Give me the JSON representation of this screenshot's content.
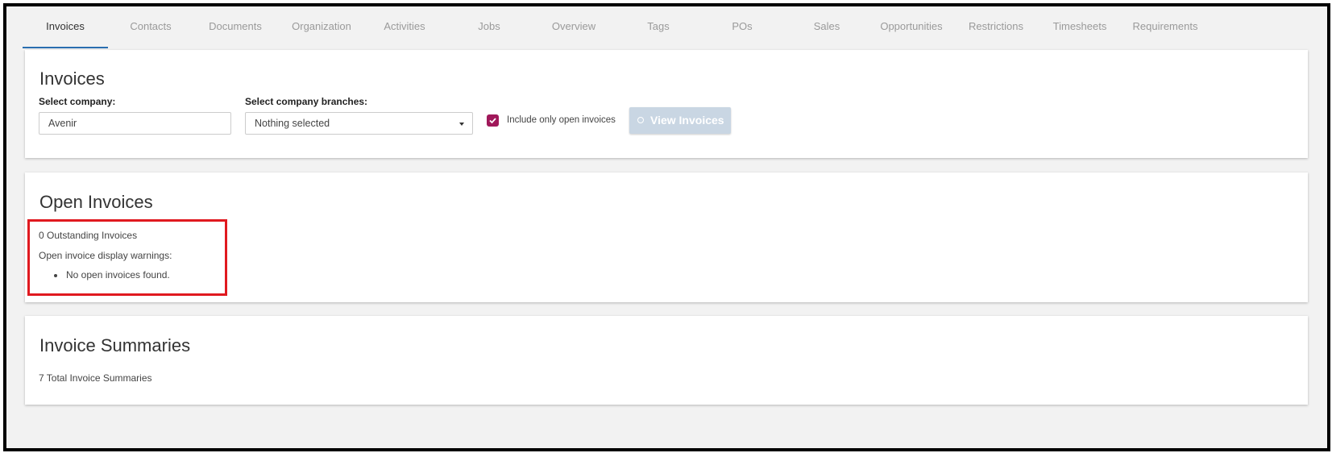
{
  "tabs": [
    {
      "label": "Invoices",
      "active": true
    },
    {
      "label": "Contacts"
    },
    {
      "label": "Documents"
    },
    {
      "label": "Organization"
    },
    {
      "label": "Activities"
    },
    {
      "label": "Jobs"
    },
    {
      "label": "Overview"
    },
    {
      "label": "Tags"
    },
    {
      "label": "POs"
    },
    {
      "label": "Sales"
    },
    {
      "label": "Opportunities"
    },
    {
      "label": "Restrictions"
    },
    {
      "label": "Timesheets"
    },
    {
      "label": "Requirements"
    }
  ],
  "invoices_card": {
    "title": "Invoices",
    "company_label": "Select company:",
    "company_value": "Avenir",
    "branches_label": "Select company branches:",
    "branches_value": "Nothing selected",
    "checkbox_label": "Include only open invoices",
    "checkbox_checked": true,
    "view_button": "View Invoices"
  },
  "open_invoices_card": {
    "title": "Open Invoices",
    "outstanding": "0 Outstanding Invoices",
    "warnings_label": "Open invoice display warnings:",
    "warnings": [
      "No open invoices found."
    ]
  },
  "summaries_card": {
    "title": "Invoice Summaries",
    "total": "7 Total Invoice Summaries"
  },
  "colors": {
    "accent_tab": "#2a6fb0",
    "checkbox": "#a0185a",
    "button_disabled": "#c9d6e3",
    "highlight": "#e0191f"
  }
}
